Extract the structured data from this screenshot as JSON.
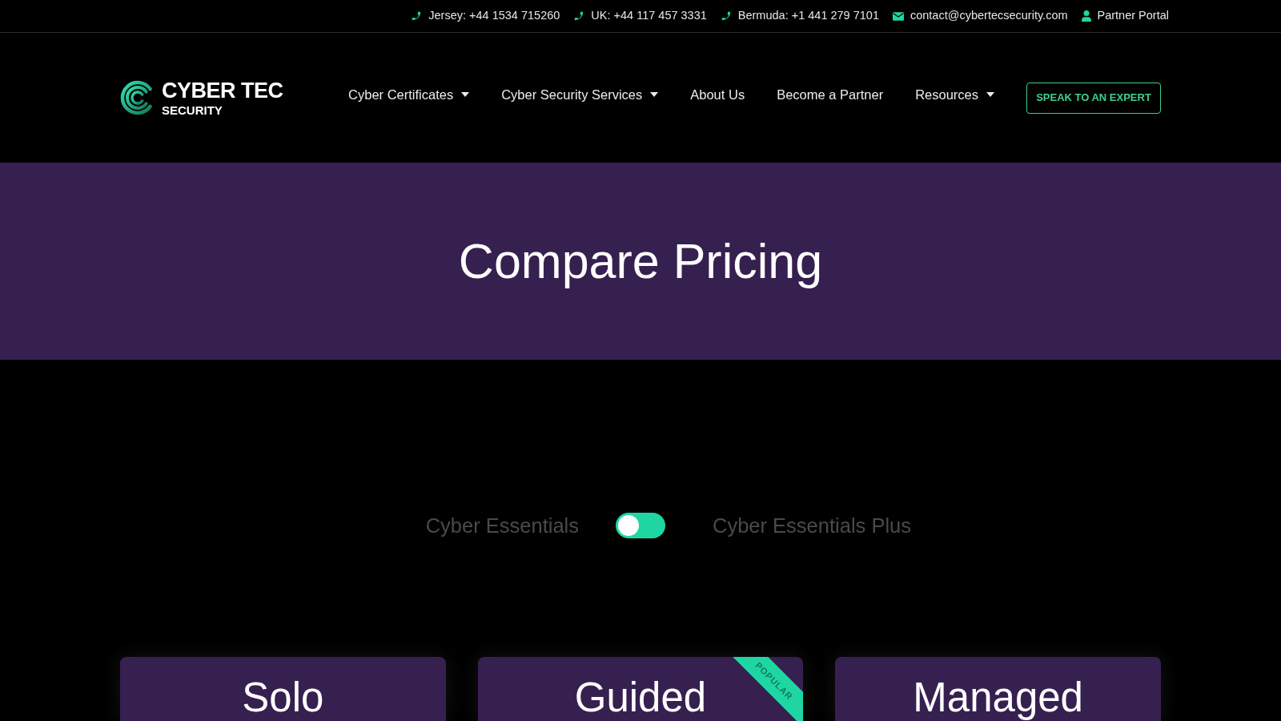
{
  "top_bar": {
    "items": [
      {
        "kind": "phone",
        "label": "Jersey: +44 1534 715260"
      },
      {
        "kind": "phone",
        "label": "UK: +44 117 457 3331"
      },
      {
        "kind": "phone",
        "label": "Bermuda: +1 441 279 7101"
      },
      {
        "kind": "email",
        "label": "contact@cybertecsecurity.com"
      },
      {
        "kind": "user",
        "label": "Partner Portal"
      }
    ]
  },
  "header": {
    "logo": {
      "name": "CYBER TEC",
      "tagline": "SECURITY"
    },
    "nav": [
      {
        "label": "Cyber Certificates",
        "has_dropdown": true
      },
      {
        "label": "Cyber Security Services",
        "has_dropdown": true
      },
      {
        "label": "About Us",
        "has_dropdown": false
      },
      {
        "label": "Become a Partner",
        "has_dropdown": false
      },
      {
        "label": "Resources",
        "has_dropdown": true
      }
    ],
    "cta": "SPEAK TO AN EXPERT"
  },
  "hero": {
    "title": "Compare Pricing"
  },
  "plan_toggle": {
    "left_label": "Cyber Essentials",
    "right_label": "Cyber Essentials Plus",
    "on": false
  },
  "plans": [
    {
      "name": "Solo"
    },
    {
      "name": "Guided",
      "ribbon": "POPULAR"
    },
    {
      "name": "Managed"
    }
  ]
}
